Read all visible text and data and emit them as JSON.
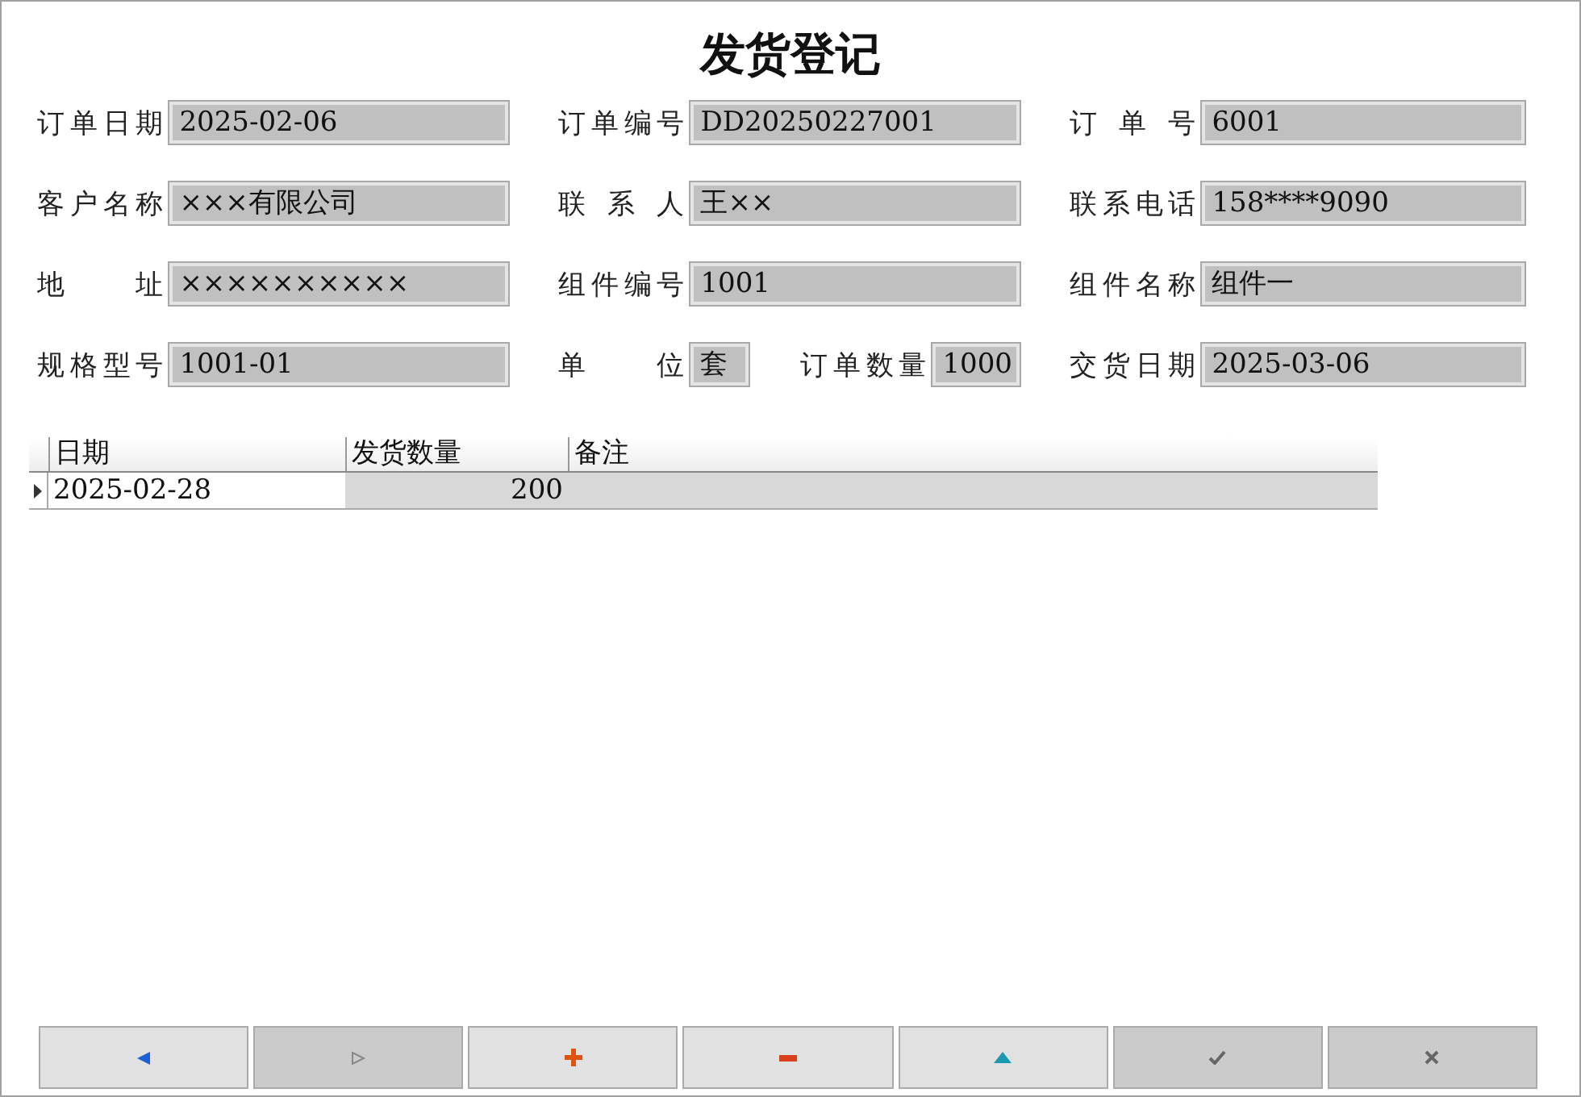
{
  "title": "发货登记",
  "rows": [
    [
      [
        {
          "label": "订单日期",
          "value": "2025-02-06"
        }
      ],
      [
        {
          "label": "订单编号",
          "value": "DD20250227001"
        }
      ],
      [
        {
          "label": "订 单 号",
          "value": "6001"
        }
      ]
    ],
    [
      [
        {
          "label": "客户名称",
          "value": "×××有限公司"
        }
      ],
      [
        {
          "label": "联 系 人",
          "value": "王××"
        }
      ],
      [
        {
          "label": "联系电话",
          "value": "158****9090"
        }
      ]
    ],
    [
      [
        {
          "label": "地　　址",
          "value": "××××××××××"
        }
      ],
      [
        {
          "label": "组件编号",
          "value": "1001"
        }
      ],
      [
        {
          "label": "组件名称",
          "value": "组件一"
        }
      ]
    ],
    [
      [
        {
          "label": "规格型号",
          "value": "1001-01"
        }
      ],
      [
        {
          "label": "单　　位",
          "value": "套"
        },
        {
          "label": "订单数量",
          "value": "1000"
        }
      ],
      [
        {
          "label": "交货日期",
          "value": "2025-03-06"
        }
      ]
    ]
  ],
  "table": {
    "columns": [
      "日期",
      "发货数量",
      "备注"
    ],
    "rows": [
      {
        "selected": true,
        "cells": [
          "2025-02-28",
          "200"
        ]
      }
    ]
  },
  "buttons": [
    {
      "kind": "prev",
      "disabled": false
    },
    {
      "kind": "next",
      "disabled": true
    },
    {
      "kind": "add",
      "disabled": false
    },
    {
      "kind": "remove",
      "disabled": false
    },
    {
      "kind": "up",
      "disabled": false
    },
    {
      "kind": "confirm",
      "disabled": true
    },
    {
      "kind": "cancel",
      "disabled": true
    }
  ]
}
